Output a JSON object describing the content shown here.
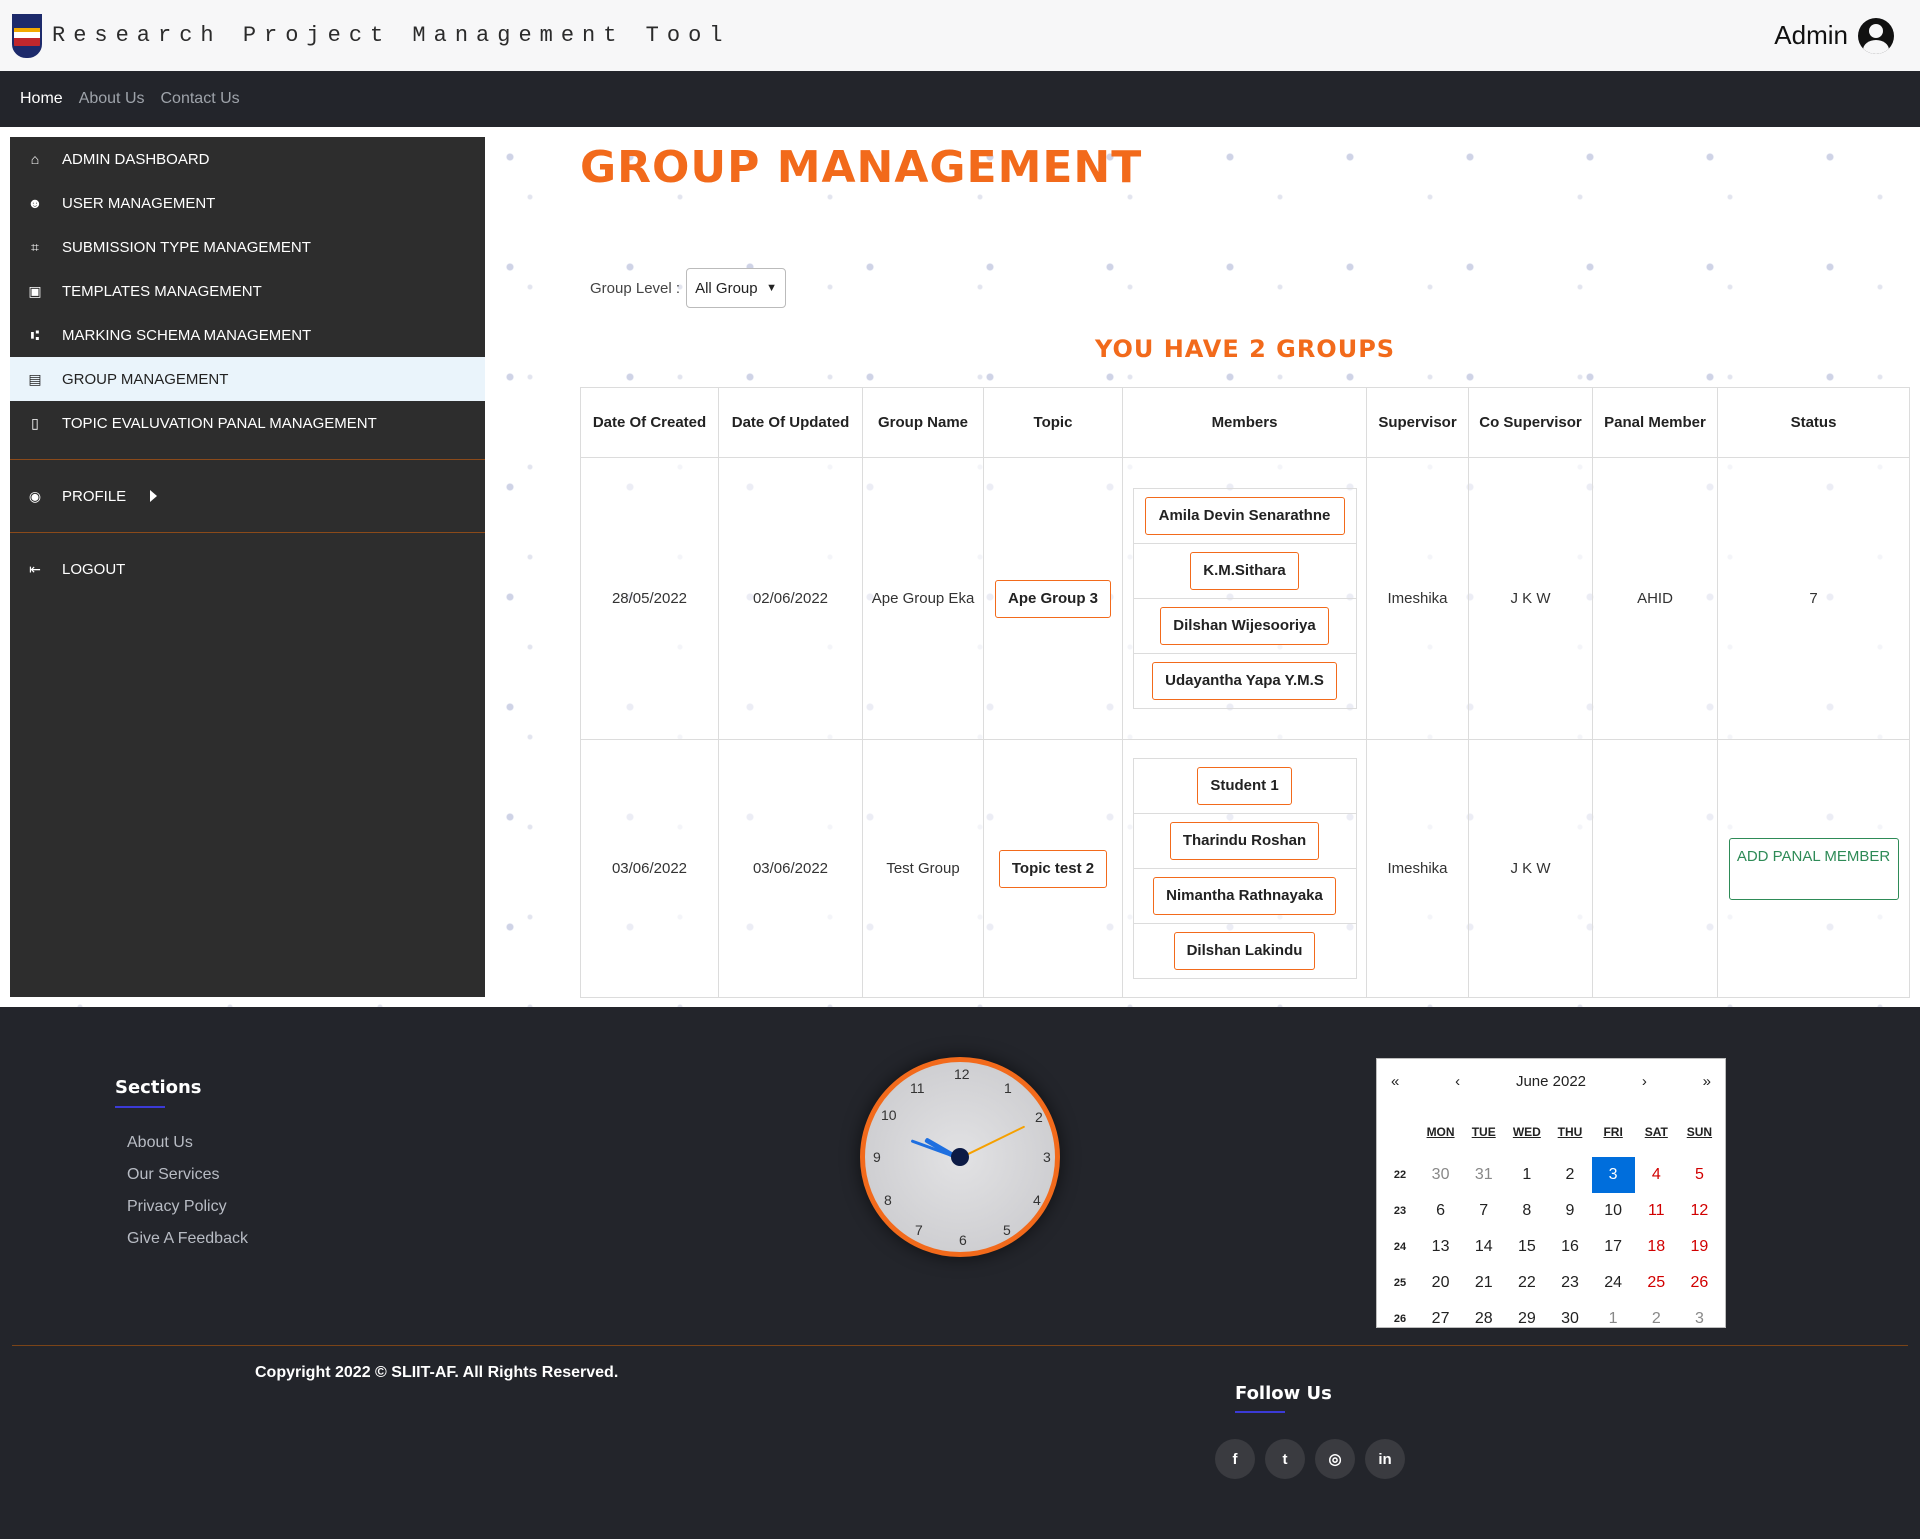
{
  "header": {
    "app_title": "Research Project Management Tool",
    "user_name": "Admin"
  },
  "nav": {
    "home": "Home",
    "about": "About Us",
    "contact": "Contact Us"
  },
  "sidebar": {
    "items": [
      {
        "label": "ADMIN DASHBOARD",
        "icon": "home-icon"
      },
      {
        "label": "USER MANAGEMENT",
        "icon": "users-icon"
      },
      {
        "label": "SUBMISSION TYPE MANAGEMENT",
        "icon": "submission-icon"
      },
      {
        "label": "TEMPLATES MANAGEMENT",
        "icon": "template-icon"
      },
      {
        "label": "MARKING SCHEMA MANAGEMENT",
        "icon": "schema-icon"
      },
      {
        "label": "GROUP MANAGEMENT",
        "icon": "group-icon"
      },
      {
        "label": "TOPIC EVALUVATION PANAL MANAGEMENT",
        "icon": "panel-icon"
      }
    ],
    "profile": "PROFILE",
    "logout": "LOGOUT"
  },
  "main": {
    "title": "GROUP MANAGEMENT",
    "filter_label": "Group Level :",
    "filter_value": "All Group",
    "groups_count": "YOU HAVE 2 GROUPS",
    "columns": [
      "Date Of Created",
      "Date Of Updated",
      "Group Name",
      "Topic",
      "Members",
      "Supervisor",
      "Co Supervisor",
      "Panal Member",
      "Status"
    ],
    "rows": [
      {
        "created": "28/05/2022",
        "updated": "02/06/2022",
        "group_name": "Ape Group Eka",
        "topic": "Ape Group 3",
        "members": [
          "Amila Devin Senarathne",
          "K.M.Sithara",
          "Dilshan Wijesooriya",
          "Udayantha Yapa Y.M.S"
        ],
        "supervisor": "Imeshika",
        "co_supervisor": "J K W",
        "panel_member": "AHID",
        "status": "7"
      },
      {
        "created": "03/06/2022",
        "updated": "03/06/2022",
        "group_name": "Test Group",
        "topic": "Topic test 2",
        "members": [
          "Student 1",
          "Tharindu Roshan",
          "Nimantha Rathnayaka",
          "Dilshan Lakindu"
        ],
        "supervisor": "Imeshika",
        "co_supervisor": "J K W",
        "panel_member": "",
        "status_button": "ADD PANAL MEMBER"
      }
    ]
  },
  "footer": {
    "sections_title": "Sections",
    "links": [
      "About Us",
      "Our Services",
      "Privacy Policy",
      "Give A Feedback"
    ],
    "copyright": "Copyright 2022 © SLIIT-AF. All Rights Reserved.",
    "follow_title": "Follow Us",
    "socials": [
      {
        "icon": "facebook-icon",
        "glyph": "f"
      },
      {
        "icon": "twitter-icon",
        "glyph": "t"
      },
      {
        "icon": "instagram-icon",
        "glyph": "◎"
      },
      {
        "icon": "linkedin-icon",
        "glyph": "in"
      }
    ]
  },
  "clock": {
    "numbers": [
      "12",
      "1",
      "2",
      "3",
      "4",
      "5",
      "6",
      "7",
      "8",
      "9",
      "10",
      "11"
    ],
    "time": "9:52"
  },
  "calendar": {
    "month": "June 2022",
    "nav": [
      "«",
      "‹",
      "›",
      "»"
    ],
    "dow": [
      "MON",
      "TUE",
      "WED",
      "THU",
      "FRI",
      "SAT",
      "SUN"
    ],
    "weeks": [
      {
        "wk": "22",
        "days": [
          "30",
          "31",
          "1",
          "2",
          "3",
          "4",
          "5"
        ]
      },
      {
        "wk": "23",
        "days": [
          "6",
          "7",
          "8",
          "9",
          "10",
          "11",
          "12"
        ]
      },
      {
        "wk": "24",
        "days": [
          "13",
          "14",
          "15",
          "16",
          "17",
          "18",
          "19"
        ]
      },
      {
        "wk": "25",
        "days": [
          "20",
          "21",
          "22",
          "23",
          "24",
          "25",
          "26"
        ]
      },
      {
        "wk": "26",
        "days": [
          "27",
          "28",
          "29",
          "30",
          "1",
          "2",
          "3"
        ]
      }
    ],
    "today": "3",
    "colors": {
      "accent": "#f26a1b",
      "today": "#006edc",
      "weekend": "#d10000"
    }
  }
}
